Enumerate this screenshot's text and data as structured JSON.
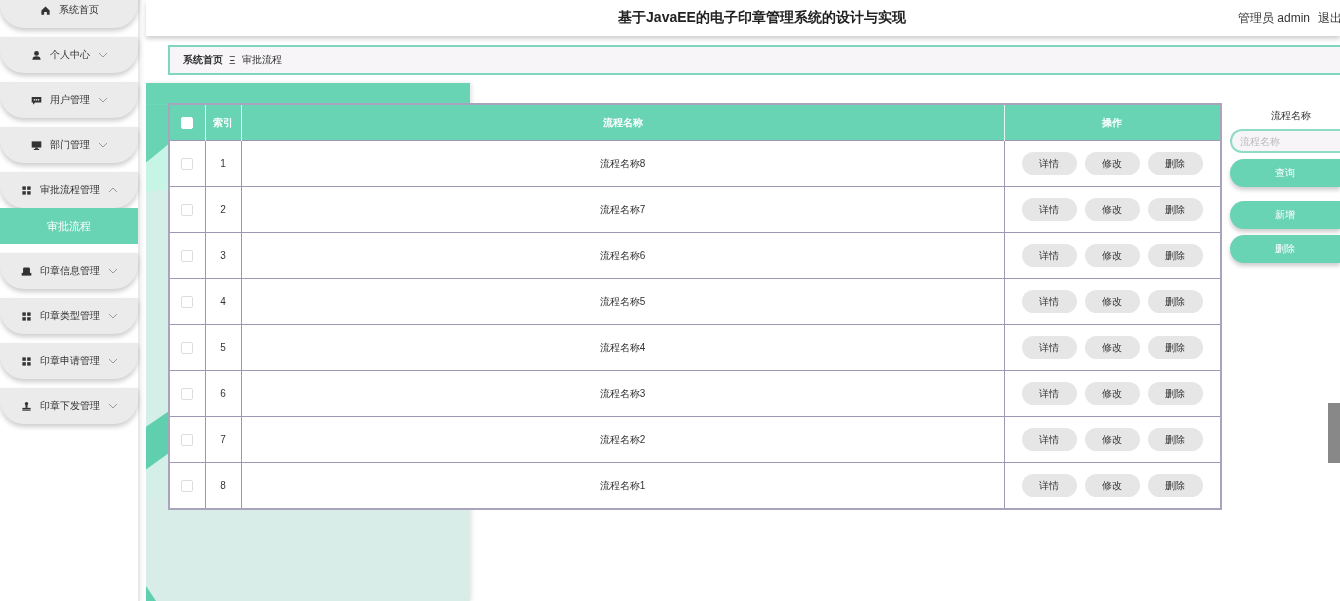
{
  "header": {
    "title": "基于JavaEE的电子印章管理系统的设计与实现",
    "user": "管理员 admin",
    "logout": "退出"
  },
  "sidebar": {
    "items": [
      {
        "label": "系统首页",
        "kind": "link"
      },
      {
        "label": "个人中心",
        "kind": "menu",
        "expanded": false
      },
      {
        "label": "用户管理",
        "kind": "menu",
        "expanded": false
      },
      {
        "label": "部门管理",
        "kind": "menu",
        "expanded": false
      },
      {
        "label": "审批流程管理",
        "kind": "menu",
        "expanded": true,
        "children": [
          {
            "label": "审批流程",
            "selected": true
          }
        ]
      },
      {
        "label": "印章信息管理",
        "kind": "menu",
        "expanded": false
      },
      {
        "label": "印章类型管理",
        "kind": "menu",
        "expanded": false
      },
      {
        "label": "印章申请管理",
        "kind": "menu",
        "expanded": false
      },
      {
        "label": "印章下发管理",
        "kind": "menu",
        "expanded": false
      }
    ]
  },
  "breadcrumb": {
    "items": [
      "系统首页",
      "审批流程"
    ],
    "separator": "Ξ"
  },
  "table": {
    "all_checked": false,
    "columns": [
      "索引",
      "流程名称",
      "操作"
    ],
    "rows": [
      {
        "index": "1",
        "name": "流程名称8",
        "checked": false,
        "actions": [
          "详情",
          "修改",
          "删除"
        ]
      },
      {
        "index": "2",
        "name": "流程名称7",
        "checked": false,
        "actions": [
          "详情",
          "修改",
          "删除"
        ]
      },
      {
        "index": "3",
        "name": "流程名称6",
        "checked": false,
        "actions": [
          "详情",
          "修改",
          "删除"
        ]
      },
      {
        "index": "4",
        "name": "流程名称5",
        "checked": false,
        "actions": [
          "详情",
          "修改",
          "删除"
        ]
      },
      {
        "index": "5",
        "name": "流程名称4",
        "checked": false,
        "actions": [
          "详情",
          "修改",
          "删除"
        ]
      },
      {
        "index": "6",
        "name": "流程名称3",
        "checked": false,
        "actions": [
          "详情",
          "修改",
          "删除"
        ]
      },
      {
        "index": "7",
        "name": "流程名称2",
        "checked": false,
        "actions": [
          "详情",
          "修改",
          "删除"
        ]
      },
      {
        "index": "8",
        "name": "流程名称1",
        "checked": false,
        "actions": [
          "详情",
          "修改",
          "删除"
        ]
      }
    ]
  },
  "search": {
    "label": "流程名称",
    "placeholder": "流程名称",
    "buttons": [
      {
        "label": "查询",
        "kind": "search"
      },
      {
        "label": "新增",
        "kind": "add"
      },
      {
        "label": "删除",
        "kind": "delete"
      }
    ]
  }
}
